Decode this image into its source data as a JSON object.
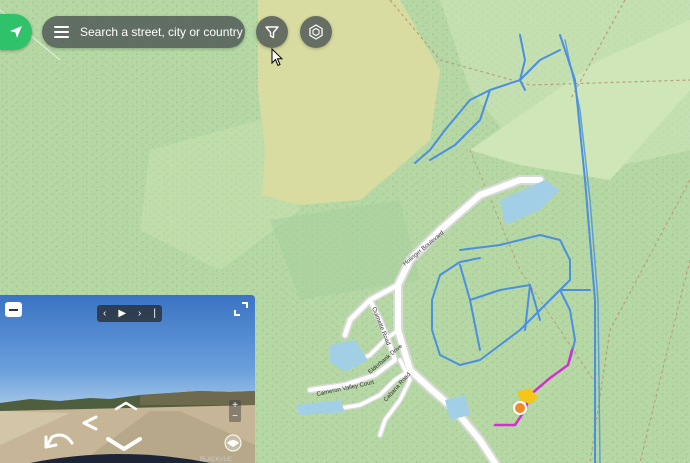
{
  "search": {
    "placeholder": "Search a street, city or country"
  },
  "icons": {
    "logo": "location-arrow-icon",
    "menu": "hamburger-menu-icon",
    "filter": "funnel-filter-icon",
    "layers": "cube-layers-icon",
    "cursor": "mouse-pointer-icon"
  },
  "map": {
    "roads": [
      "Holinger Boulevard",
      "Ouimette Road",
      "Elderbank Drive",
      "Cameron Valley Court",
      "Cabana Road"
    ]
  },
  "viewer": {
    "controls": {
      "prev": "‹",
      "play": "▶",
      "next": "›",
      "bar": "|",
      "zoom_in": "+",
      "zoom_out": "−"
    },
    "watermark": "BLACKVUE"
  },
  "colors": {
    "brand_green": "#2fc26b",
    "track_blue": "#4a8fe0",
    "track_magenta": "#d230d0",
    "marker_orange": "#f08a24",
    "marker_yellow": "#f5c518"
  }
}
